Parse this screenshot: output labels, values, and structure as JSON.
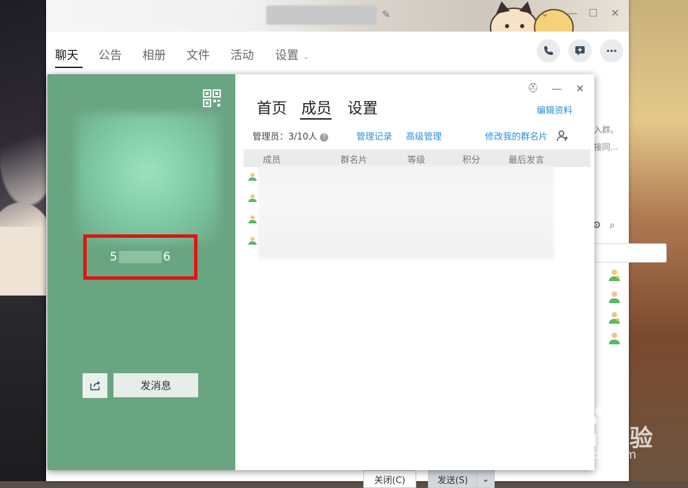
{
  "chat_window": {
    "tabs": [
      {
        "label": "聊天",
        "active": true
      },
      {
        "label": "公告",
        "active": false
      },
      {
        "label": "相册",
        "active": false
      },
      {
        "label": "文件",
        "active": false
      },
      {
        "label": "活动",
        "active": false
      },
      {
        "label": "设置",
        "active": false
      }
    ],
    "side_snippets": [
      "入群。",
      "接同..."
    ],
    "bottom_buttons": {
      "close": "关闭(C)",
      "send": "发送(S)"
    }
  },
  "group_card": {
    "group_id_prefix": "5",
    "group_id_suffix": "6",
    "send_message_label": "发消息",
    "tabs": [
      "首页",
      "成员",
      "设置"
    ],
    "active_tab": "成员",
    "edit_profile_link": "编辑资料",
    "admin_summary": "管理员：3/10人",
    "links": {
      "manage_log": "管理记录",
      "advanced_manage": "高级管理",
      "edit_my_card": "修改我的群名片"
    },
    "table_headers": [
      "成员",
      "群名片",
      "等级",
      "积分",
      "最后发言"
    ],
    "row_count": 4
  },
  "watermark": {
    "logo_text": "Baidu 经验",
    "url": "jingyan.baidu.com"
  },
  "colors": {
    "panel_green": "#6aa582",
    "highlight_red": "#e01414",
    "link_blue": "#2b8fd6"
  }
}
